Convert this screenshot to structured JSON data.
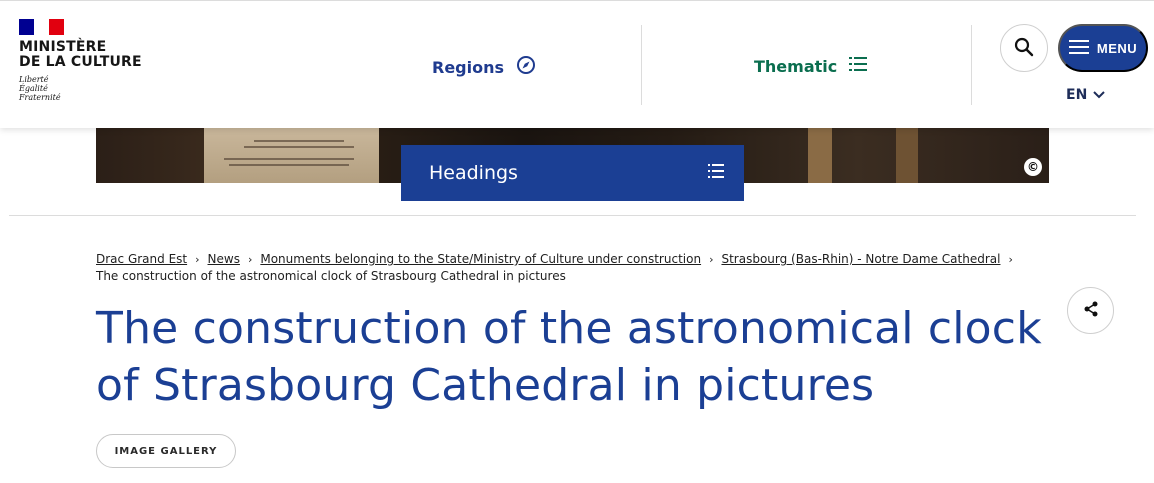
{
  "header": {
    "logo_lines": [
      "MINISTÈRE",
      "DE LA CULTURE"
    ],
    "motto_lines": [
      "Liberté",
      "Égalité",
      "Fraternité"
    ],
    "nav": {
      "regions_label": "Regions",
      "thematic_label": "Thematic"
    },
    "menu_label": "MENU",
    "language": "EN"
  },
  "banner": {
    "headings_label": "Headings",
    "copyright_symbol": "©"
  },
  "breadcrumb": {
    "items": [
      "Drac Grand Est",
      "News",
      "Monuments belonging to the State/Ministry of Culture under construction",
      "Strasbourg (Bas-Rhin) - Notre Dame Cathedral"
    ],
    "current": "The construction of the astronomical clock of Strasbourg Cathedral in pictures"
  },
  "page": {
    "title": "The construction of the astronomical clock of Strasbourg Cathedral in pictures",
    "tag": "IMAGE GALLERY"
  },
  "colors": {
    "brand_blue": "#1b3f94",
    "thematic_green": "#0b6e4f",
    "flag_blue": "#000091",
    "flag_red": "#e1000f"
  },
  "icons": {
    "regions": "compass-icon",
    "thematic": "list-icon",
    "search": "search-icon",
    "menu": "hamburger-icon",
    "language": "chevron-down-icon",
    "headings": "list-icon",
    "share": "share-icon",
    "copyright": "copyright-icon"
  }
}
